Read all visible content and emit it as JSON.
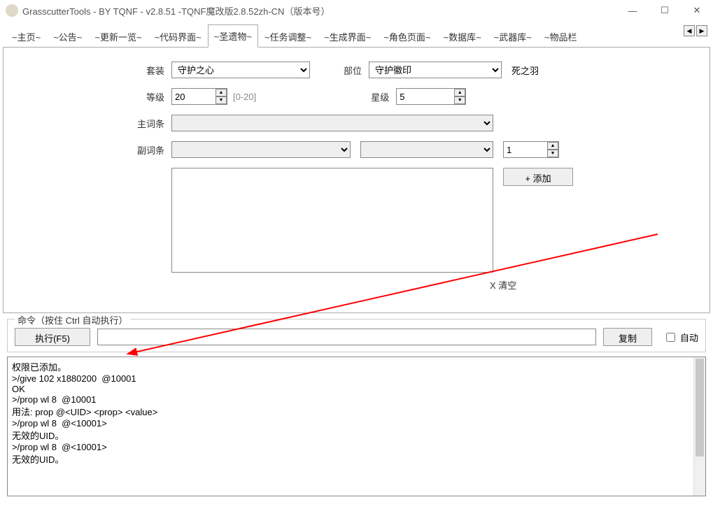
{
  "window": {
    "title": "GrasscutterTools  - BY TQNF  - v2.8.51 -TQNF魔改版2.8.52zh-CN（版本号）"
  },
  "tabs": [
    "~主页~",
    "~公告~",
    "~更新一览~",
    "~代码界面~",
    "~圣遗物~",
    "~任务调整~",
    "~生成界面~",
    "~角色页面~",
    "~数据库~",
    "~武器库~",
    "~物品栏"
  ],
  "activeTab": 4,
  "labels": {
    "set": "套装",
    "slot": "部位",
    "level": "等级",
    "levelRange": "[0-20]",
    "star": "星级",
    "mainStat": "主词条",
    "subStat": "副词条",
    "add": "+ 添加",
    "clear": "X 清空",
    "pieceName": "死之羽"
  },
  "values": {
    "setValue": "守护之心",
    "slotValue": "守护徽印",
    "level": "20",
    "star": "5",
    "mainStat": "",
    "subStatName": "",
    "subStatAux": "",
    "subStatCount": "1",
    "subList": ""
  },
  "command": {
    "legend": "命令（按住 Ctrl 自动执行）",
    "execute": "执行(F5)",
    "copy": "复制",
    "auto": "自动",
    "value": ""
  },
  "log": "权限已添加。\n>/give 102 x1880200  @10001\nOK\n>/prop wl 8  @10001\n用法: prop @<UID> <prop> <value>\n>/prop wl 8  @<10001>\n无效的UID。\n>/prop wl 8  @<10001>\n无效的UID。"
}
